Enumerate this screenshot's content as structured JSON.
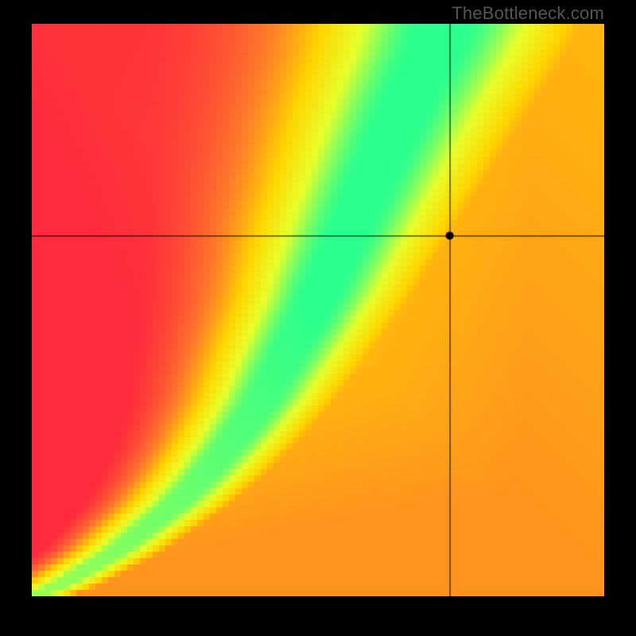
{
  "attribution": "TheBottleneck.com",
  "chart_data": {
    "type": "heatmap",
    "title": "",
    "xlabel": "",
    "ylabel": "",
    "x_range": [
      0,
      1
    ],
    "y_range": [
      0,
      1
    ],
    "crosshair": {
      "x": 0.73,
      "y": 0.63
    },
    "marker": {
      "x": 0.73,
      "y": 0.63
    },
    "ridge_points": [
      {
        "x": 0.0,
        "y": 0.0
      },
      {
        "x": 0.05,
        "y": 0.02
      },
      {
        "x": 0.1,
        "y": 0.05
      },
      {
        "x": 0.15,
        "y": 0.08
      },
      {
        "x": 0.2,
        "y": 0.12
      },
      {
        "x": 0.25,
        "y": 0.16
      },
      {
        "x": 0.3,
        "y": 0.21
      },
      {
        "x": 0.35,
        "y": 0.27
      },
      {
        "x": 0.4,
        "y": 0.34
      },
      {
        "x": 0.45,
        "y": 0.43
      },
      {
        "x": 0.5,
        "y": 0.52
      },
      {
        "x": 0.55,
        "y": 0.63
      },
      {
        "x": 0.6,
        "y": 0.74
      },
      {
        "x": 0.65,
        "y": 0.85
      },
      {
        "x": 0.7,
        "y": 0.95
      },
      {
        "x": 0.72,
        "y": 1.0
      }
    ],
    "ridge_width_norm": 0.06,
    "colorscale": [
      "#ff2a3c",
      "#ff7a2a",
      "#ffd400",
      "#e7ff2a",
      "#2aff8e"
    ],
    "pixelation": 90,
    "grid_on": false,
    "legend": false
  }
}
